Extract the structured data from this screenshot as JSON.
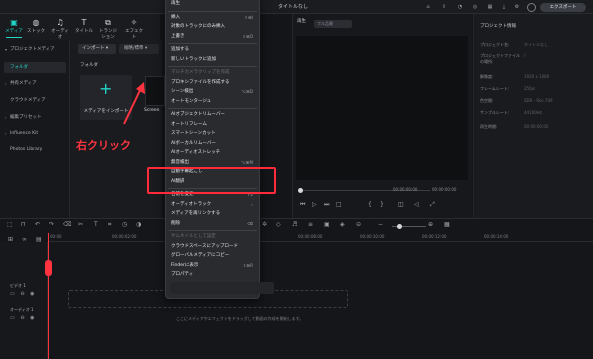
{
  "window": {
    "title": "タイトルなし",
    "export_label": "エクスポート"
  },
  "tabs": [
    {
      "label": "メディア",
      "icon": "media-icon"
    },
    {
      "label": "ストック",
      "icon": "stock-icon"
    },
    {
      "label": "オーディオ",
      "icon": "music-note-icon"
    },
    {
      "label": "タイトル",
      "icon": "text-icon"
    },
    {
      "label": "トランジション",
      "icon": "transition-icon"
    },
    {
      "label": "エフェクト",
      "icon": "effect-icon"
    }
  ],
  "sidebar": {
    "items": [
      {
        "label": "プロジェクトメディア",
        "arrow": "▾"
      },
      {
        "label": "フォルダ",
        "arrow": ""
      },
      {
        "label": "共有メディア",
        "arrow": "›"
      },
      {
        "label": "クラウドメディア",
        "arrow": ""
      },
      {
        "label": "編集プリセット",
        "arrow": "›"
      },
      {
        "label": "Influence Kit",
        "arrow": "›"
      },
      {
        "label": "Photos Library",
        "arrow": ""
      }
    ]
  },
  "media": {
    "import_label": "インポート",
    "sort_label": "縮略/標準",
    "folder_label": "フォルダ",
    "import_tile_label": "メディアをインポート",
    "screen_tile_label": "Screen"
  },
  "annotation": {
    "text": "右クリック",
    "color": "#ff3340"
  },
  "preview": {
    "label": "再生",
    "quality": "フル品質",
    "time_a": "00:00:00:00",
    "time_b": "00:00:00:00"
  },
  "info": {
    "title": "プロジェクト情報",
    "rows": [
      {
        "k": "プロジェクト名:",
        "v": "タイトルなし"
      },
      {
        "k": "プロジェクトファイルの場所:",
        "v": "/"
      },
      {
        "k": "解像度:",
        "v": "1920 x 1080"
      },
      {
        "k": "フレームレート:",
        "v": "25fps"
      },
      {
        "k": "色空間:",
        "v": "SDR - Rec.709"
      },
      {
        "k": "サンプルレート:",
        "v": "44100Hz"
      },
      {
        "k": "再生時間:",
        "v": "00:00:00:00"
      }
    ]
  },
  "timeline": {
    "ticks": [
      "00:00",
      "00:00:02:00",
      "00:00:04:00",
      "00:00:06:00",
      "00:00:08:00",
      "00:00:10:00",
      "00:00:12:00",
      "00:00:14:00"
    ],
    "tracks": [
      {
        "label": "ビデオ 1"
      },
      {
        "label": "オーディオ 1"
      }
    ],
    "drop_hint": "ここにメディアやエフェクトをドラッグして動画の作成を開始します。"
  },
  "context_menu": {
    "items": [
      {
        "label": "再生",
        "shortcut": "",
        "disabled": false,
        "sep_after": true
      },
      {
        "label": "挿入",
        "shortcut": "⇧⌘I",
        "disabled": false
      },
      {
        "label": "対象のトラックにのみ挿入",
        "shortcut": "",
        "disabled": false
      },
      {
        "label": "上書き",
        "shortcut": "⇧⌘O",
        "disabled": false,
        "sep_after": true
      },
      {
        "label": "追加する",
        "shortcut": "",
        "disabled": false
      },
      {
        "label": "新しいトラックに追加",
        "shortcut": "",
        "disabled": false,
        "sep_after": true
      },
      {
        "label": "マルチカメラクリップを作成",
        "shortcut": "",
        "disabled": true
      },
      {
        "label": "プロキシファイルを作成する",
        "shortcut": "",
        "disabled": false
      },
      {
        "label": "シーン検出",
        "shortcut": "⌥⌘D",
        "disabled": false
      },
      {
        "label": "オートモンタージュ",
        "shortcut": "",
        "disabled": false,
        "sep_after": true
      },
      {
        "label": "AIオブジェクトリムーバー",
        "shortcut": "",
        "disabled": false
      },
      {
        "label": "オートリフレーム",
        "shortcut": "",
        "disabled": false
      },
      {
        "label": "スマートシーンカット",
        "shortcut": "",
        "disabled": false
      },
      {
        "label": "AIボーカルリムーバー",
        "shortcut": "",
        "disabled": false
      },
      {
        "label": "AIオーディオストレッチ",
        "shortcut": "",
        "disabled": false
      },
      {
        "label": "無音検出",
        "shortcut": "⌥⌘M",
        "disabled": false
      },
      {
        "label": "自動字幕起こし",
        "shortcut": "",
        "disabled": false
      },
      {
        "label": "AI翻訳",
        "shortcut": "",
        "disabled": false,
        "sep_after": true
      },
      {
        "label": "名前を変更",
        "shortcut": "F2",
        "disabled": false
      },
      {
        "label": "オーディオトラック",
        "shortcut": "›",
        "disabled": false
      },
      {
        "label": "メディアを再リンクする",
        "shortcut": "",
        "disabled": false
      },
      {
        "label": "削除",
        "shortcut": "⌫",
        "disabled": false,
        "sep_after": true
      },
      {
        "label": "サムネイルとして設定",
        "shortcut": "",
        "disabled": true
      },
      {
        "label": "クラウドスペースにアップロード",
        "shortcut": "",
        "disabled": false
      },
      {
        "label": "グローバルメディアにコピー",
        "shortcut": "",
        "disabled": false
      },
      {
        "label": "Finderに表示",
        "shortcut": "⇧⌘R",
        "disabled": false
      },
      {
        "label": "プロパティ",
        "shortcut": "",
        "disabled": false
      }
    ]
  }
}
